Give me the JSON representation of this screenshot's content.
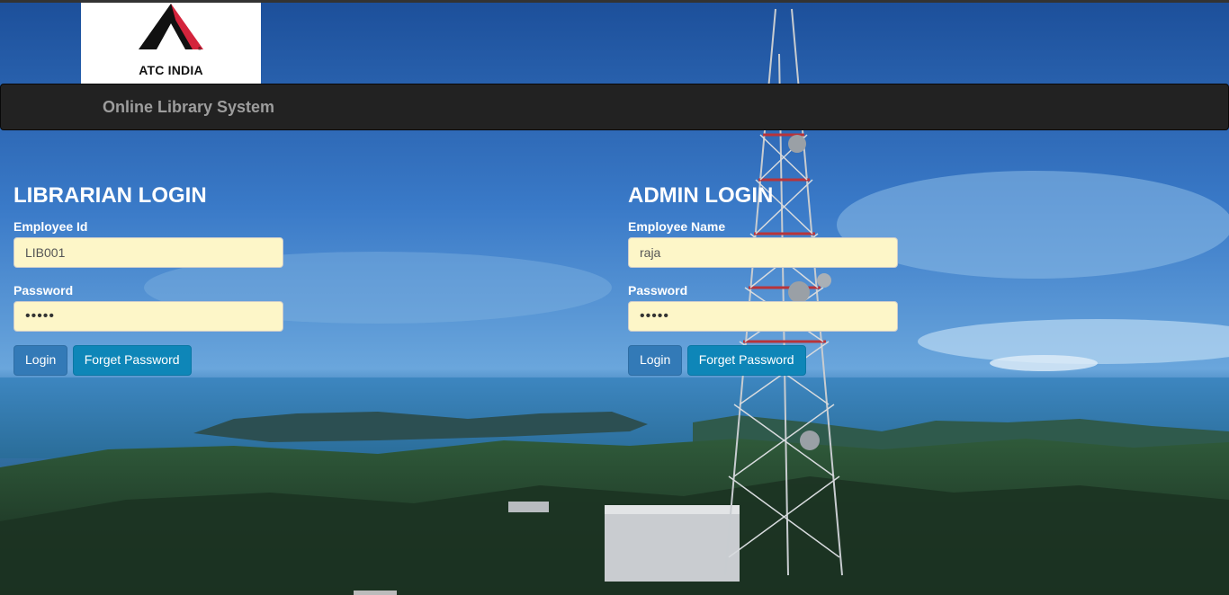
{
  "brand": {
    "logo_text": "ATC INDIA",
    "title": "Online Library System",
    "colors": {
      "logo_black": "#111111",
      "logo_red": "#d4243c"
    }
  },
  "librarian": {
    "heading": "LIBRARIAN LOGIN",
    "id_label": "Employee Id",
    "id_value": "LIB001",
    "password_label": "Password",
    "password_value": "•••••",
    "login_label": "Login",
    "forget_label": "Forget Password"
  },
  "admin": {
    "heading": "ADMIN LOGIN",
    "name_label": "Employee Name",
    "name_value": "raja",
    "password_label": "Password",
    "password_value": "•••••",
    "login_label": "Login",
    "forget_label": "Forget Password"
  },
  "colors": {
    "navbar": "#222222",
    "input_bg": "#fdf6c8",
    "btn_primary": "#337ab7",
    "btn_info": "#0e86b8"
  }
}
